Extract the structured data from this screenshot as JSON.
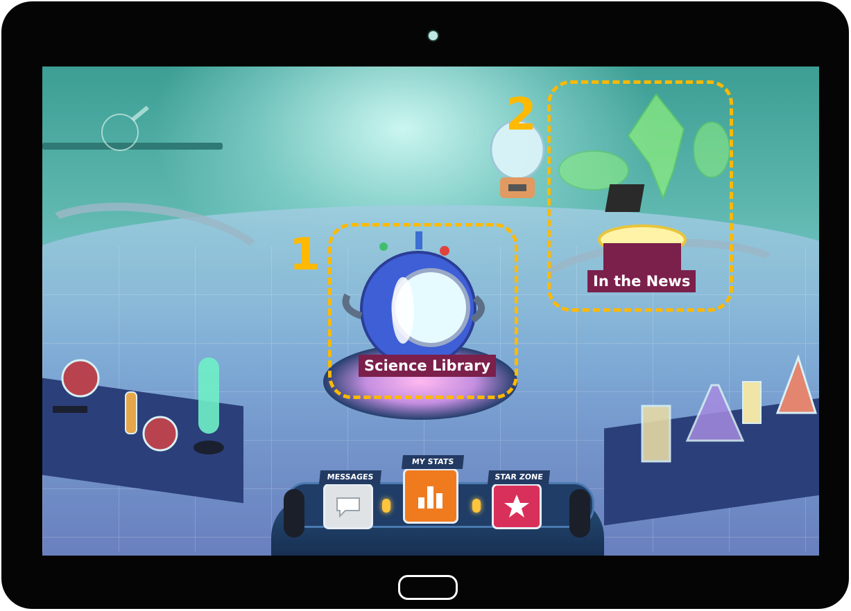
{
  "device": {
    "type": "tablet"
  },
  "scene": {
    "annotations": [
      {
        "number": "1",
        "target": "Science Library"
      },
      {
        "number": "2",
        "target": "In the News"
      }
    ],
    "stations": {
      "science_library": {
        "label": "Science Library"
      },
      "in_the_news": {
        "label": "In the News"
      }
    }
  },
  "dashboard": {
    "messages": {
      "label": "MESSAGES",
      "icon": "speech-bubble-icon"
    },
    "my_stats": {
      "label": "MY STATS",
      "icon": "bar-chart-icon"
    },
    "star_zone": {
      "label": "STAR ZONE",
      "icon": "star-icon"
    }
  },
  "colors": {
    "annotation": "#ffb900",
    "label_bg": "#7b1f4b",
    "messages": "#dfe3e6",
    "my_stats": "#f07b1f",
    "star_zone": "#d8305a"
  }
}
